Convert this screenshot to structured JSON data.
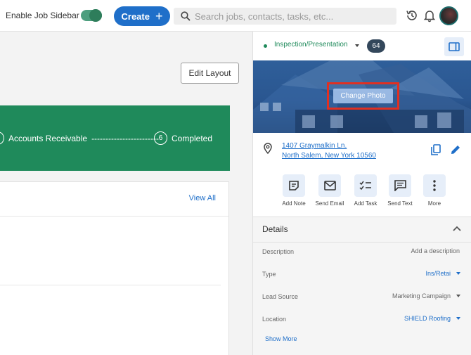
{
  "topbar": {
    "toggle_label": "Enable Job Sidebar",
    "toggle_on": true,
    "create_label": "Create",
    "search_placeholder": "Search jobs, contacts, tasks, etc..."
  },
  "main": {
    "edit_layout_label": "Edit Layout",
    "stages": [
      {
        "number": "",
        "label": "Accounts Receivable"
      },
      {
        "number": "6",
        "label": "Completed"
      }
    ],
    "stage_connector": "------------------------",
    "card": {
      "view_all_label": "View All"
    }
  },
  "sidebar": {
    "status": "Inspection/Presentation",
    "count": "64",
    "change_photo_label": "Change Photo",
    "address_line1": "1407 Graymalkin Ln.",
    "address_line2": "North Salem, New York 10560",
    "actions": [
      {
        "label": "Add Note",
        "icon": "note-icon"
      },
      {
        "label": "Send Email",
        "icon": "email-icon"
      },
      {
        "label": "Add Task",
        "icon": "task-icon"
      },
      {
        "label": "Send Text",
        "icon": "text-message-icon"
      },
      {
        "label": "More",
        "icon": "more-vertical-icon"
      }
    ],
    "details": {
      "title": "Details",
      "rows": [
        {
          "label": "Description",
          "value": "Add a description"
        },
        {
          "label": "Type",
          "value": "Ins/Retai"
        },
        {
          "label": "Lead Source",
          "value": "Marketing Campaign"
        },
        {
          "label": "Location",
          "value": "SHIELD Roofing"
        }
      ],
      "show_more_label": "Show More"
    }
  },
  "colors": {
    "brand_blue": "#1f6fc9",
    "stage_green": "#1f8a5b",
    "badge_navy": "#33475b",
    "highlight_red": "#e03022"
  }
}
